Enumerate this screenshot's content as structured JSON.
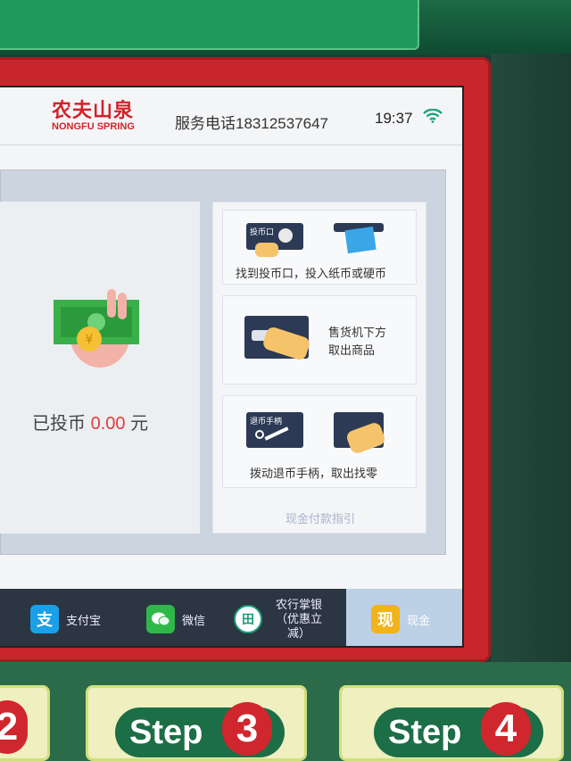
{
  "header": {
    "brand_cn": "农夫山泉",
    "brand_en": "NONGFU SPRING",
    "hotline": "服务电话18312537647",
    "time": "19:37"
  },
  "payment": {
    "inserted_label": "已投币",
    "amount": "0.00",
    "currency": "元"
  },
  "guide": {
    "steps": [
      {
        "tag": "投币口",
        "text": "找到投币口，投入纸币或硬币"
      },
      {
        "text_line1": "售货机下方",
        "text_line2": "取出商品"
      },
      {
        "tag": "退币手柄",
        "text": "拨动退币手柄，取出找零"
      }
    ],
    "title": "现金付款指引"
  },
  "tabs": [
    {
      "label": "支付宝",
      "icon": "alipay-icon",
      "color": "#1aa0e8"
    },
    {
      "label": "微信",
      "icon": "wechat-icon",
      "color": "#2fb84a"
    },
    {
      "label": "农行掌银（优惠立减）",
      "icon": "abc-bank-icon",
      "color": "#1a9b7a"
    },
    {
      "label": "现金",
      "icon": "cash-icon",
      "color": "#f2b31b",
      "active": true
    }
  ],
  "machine": {
    "step3_word": "Step",
    "step3_num": "3",
    "step4_word": "Step",
    "step4_num": "4",
    "step2_num": "2"
  }
}
